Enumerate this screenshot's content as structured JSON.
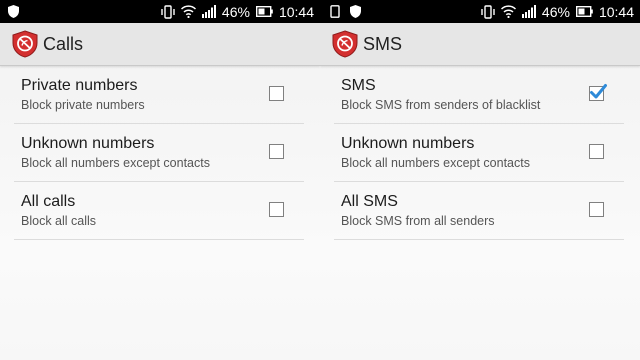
{
  "status_bar": {
    "battery": "46%",
    "time": "10:44"
  },
  "calls_screen": {
    "title": "Calls",
    "items": [
      {
        "title": "Private numbers",
        "subtitle": "Block private numbers",
        "checked": false
      },
      {
        "title": "Unknown numbers",
        "subtitle": "Block all numbers except contacts",
        "checked": false
      },
      {
        "title": "All calls",
        "subtitle": "Block all calls",
        "checked": false
      }
    ]
  },
  "sms_screen": {
    "title": "SMS",
    "items": [
      {
        "title": "SMS",
        "subtitle": "Block SMS from senders of blacklist",
        "checked": true
      },
      {
        "title": "Unknown numbers",
        "subtitle": "Block all numbers except contacts",
        "checked": false
      },
      {
        "title": "All SMS",
        "subtitle": "Block SMS from all senders",
        "checked": false
      }
    ]
  },
  "colors": {
    "check_accent": "#2e8ad8",
    "app_icon_red": "#d32f2f"
  }
}
